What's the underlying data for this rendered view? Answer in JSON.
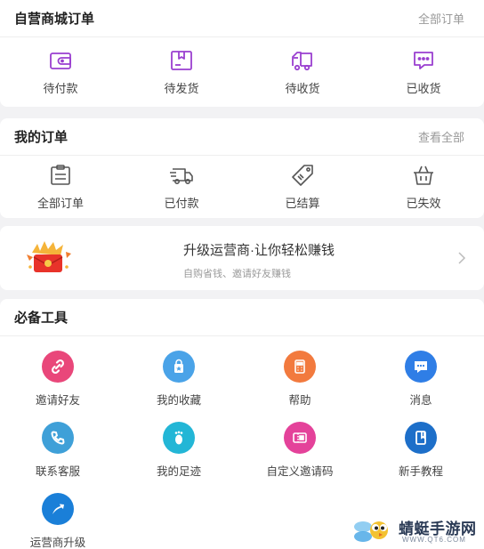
{
  "self_orders": {
    "title": "自营商城订单",
    "link": "全部订单",
    "items": [
      {
        "label": "待付款",
        "icon": "wallet-icon"
      },
      {
        "label": "待发货",
        "icon": "package-icon"
      },
      {
        "label": "待收货",
        "icon": "truck-icon"
      },
      {
        "label": "已收货",
        "icon": "chat-bubble-icon"
      }
    ]
  },
  "my_orders": {
    "title": "我的订单",
    "link": "查看全部",
    "items": [
      {
        "label": "全部订单",
        "icon": "clipboard-icon"
      },
      {
        "label": "已付款",
        "icon": "delivery-truck-icon"
      },
      {
        "label": "已结算",
        "icon": "tag-icon"
      },
      {
        "label": "已失效",
        "icon": "basket-icon"
      }
    ]
  },
  "promo": {
    "title": "升级运营商·让你轻松赚钱",
    "subtitle": "自购省钱、邀请好友赚钱",
    "icon": "red-envelope-icon"
  },
  "tools": {
    "title": "必备工具",
    "items": [
      {
        "label": "邀请好友",
        "icon": "link-icon",
        "color": "#e9477a"
      },
      {
        "label": "我的收藏",
        "icon": "gift-bag-icon",
        "color": "#4aa3e8"
      },
      {
        "label": "帮助",
        "icon": "calculator-icon",
        "color": "#f27a3e"
      },
      {
        "label": "消息",
        "icon": "message-icon",
        "color": "#2f7ee6"
      },
      {
        "label": "联系客服",
        "icon": "phone-icon",
        "color": "#3fa0d8"
      },
      {
        "label": "我的足迹",
        "icon": "footprint-icon",
        "color": "#23b6d6"
      },
      {
        "label": "自定义邀请码",
        "icon": "ticket-icon",
        "color": "#e4429a"
      },
      {
        "label": "新手教程",
        "icon": "book-icon",
        "color": "#1d6fc9"
      },
      {
        "label": "运营商升级",
        "icon": "upgrade-arrow-icon",
        "color": "#1a7fd8"
      }
    ]
  },
  "watermark": {
    "text": "蜻蜓手游网",
    "sub": "WWW.QT6.COM"
  },
  "colors": {
    "accent_purple": "#9a3fd0",
    "order_icon_gray": "#555555"
  }
}
